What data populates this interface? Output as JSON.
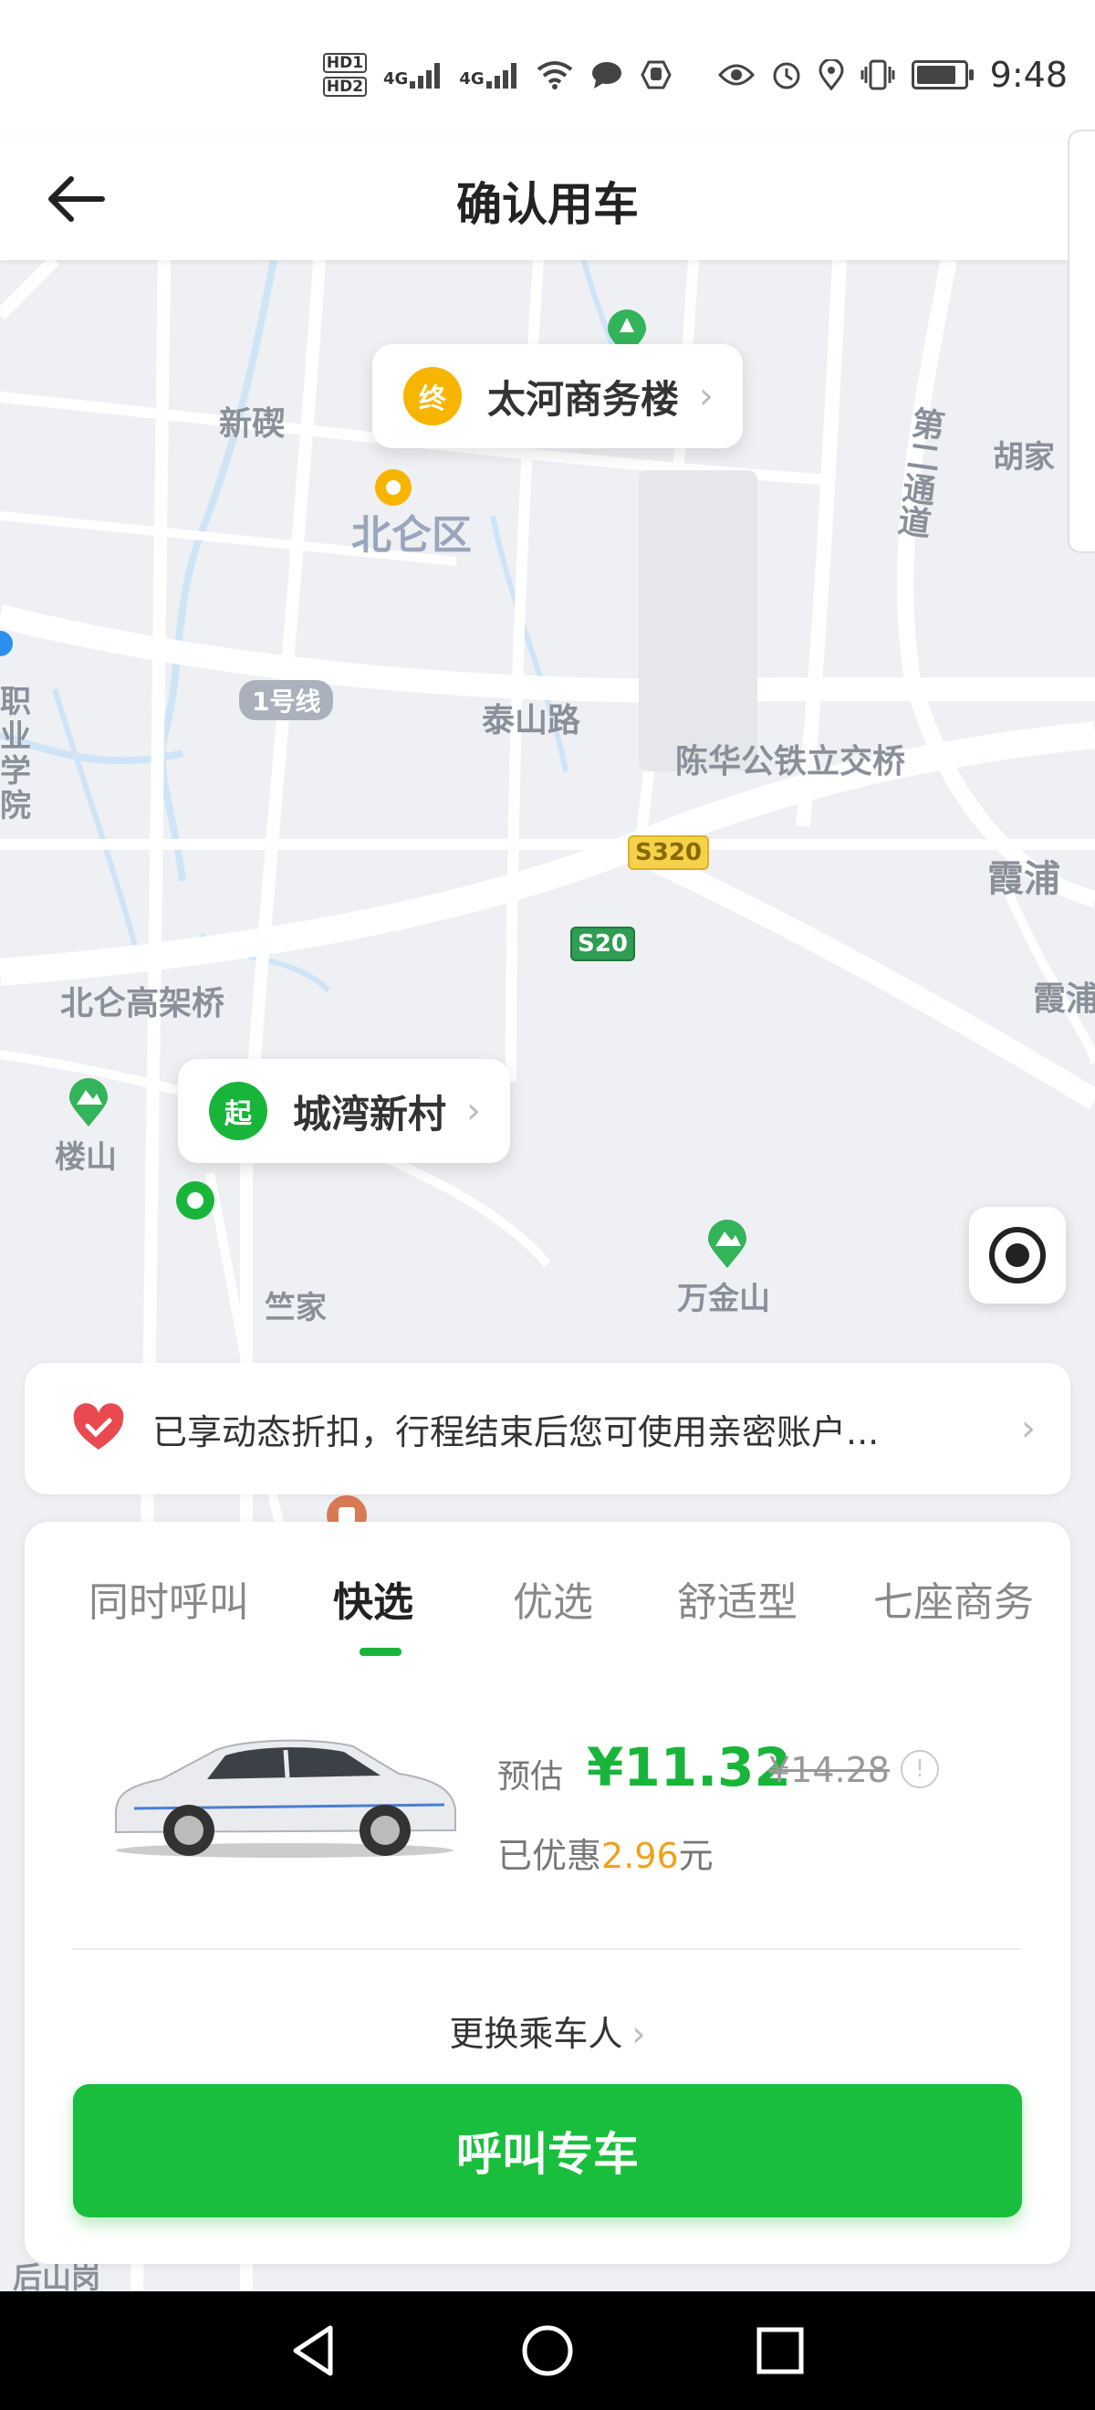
{
  "status_bar": {
    "time": "9:48",
    "network_1": "4G",
    "network_2": "4G",
    "hd_1": "HD1",
    "hd_2": "HD2"
  },
  "header": {
    "title": "确认用车",
    "back_icon": "back-arrow-icon"
  },
  "map": {
    "labels": {
      "xinqi": "新碶",
      "beilun_district": "北仑区",
      "hujia": "胡家",
      "second_channel": "第二通道",
      "line1": "1号线",
      "taishan_road": "泰山路",
      "chenhua_bridge": "陈华公铁立交桥",
      "xiapu": "霞浦",
      "xiapu2": "霞浦",
      "beilun_viaduct": "北仑高架桥",
      "loushan": "楼山",
      "zhujia": "竺家",
      "wanjinshan": "万金山",
      "vocational": "职业学院",
      "houshan": "后山岗",
      "s320": "S320",
      "s20": "S20"
    },
    "destination": {
      "badge": "终",
      "name": "太河商务楼",
      "color": "#f7b500"
    },
    "origin": {
      "badge": "起",
      "name": "城湾新村",
      "color": "#19b53b"
    }
  },
  "notice": {
    "text": "已享动态折扣，行程结束后您可使用亲密账户...",
    "icon": "heart-icon"
  },
  "panel": {
    "tabs": [
      {
        "label": "同时呼叫",
        "active": false
      },
      {
        "label": "快选",
        "active": true
      },
      {
        "label": "优选",
        "active": false
      },
      {
        "label": "舒适型",
        "active": false
      },
      {
        "label": "七座商务",
        "active": false
      }
    ],
    "estimate_label": "预估",
    "price": "¥11.32",
    "original_price": "¥14.28",
    "discount_prefix": "已优惠",
    "discount_amount": "2.96",
    "discount_suffix": "元",
    "change_passenger": "更换乘车人",
    "call_button": "呼叫专车"
  },
  "colors": {
    "accent_green": "#19bf3c",
    "discount_orange": "#f0a21c"
  }
}
